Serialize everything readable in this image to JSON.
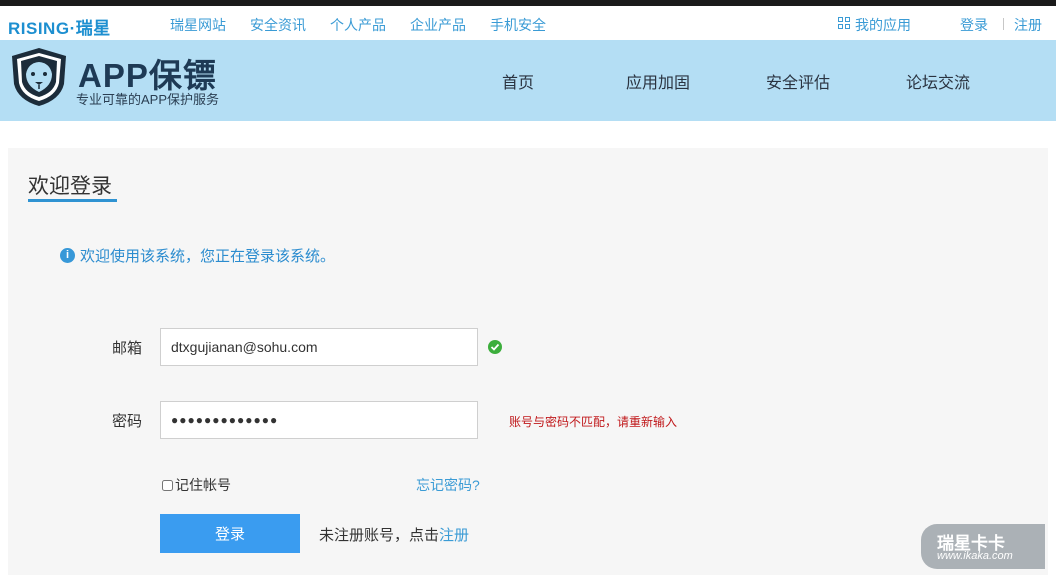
{
  "topbar": {
    "brand_en": "RISING",
    "brand_dot": "·",
    "brand_cn": "瑞星",
    "nav": [
      "瑞星网站",
      "安全资讯",
      "个人产品",
      "企业产品",
      "手机安全"
    ],
    "my_apps": "我的应用",
    "login": "登录",
    "register": "注册"
  },
  "header": {
    "title": "APP保镖",
    "subtitle": "专业可靠的APP保护服务",
    "nav": [
      "首页",
      "应用加固",
      "安全评估",
      "论坛交流"
    ]
  },
  "login": {
    "title": "欢迎登录",
    "info": "欢迎使用该系统，您正在登录该系统。",
    "email_label": "邮箱",
    "email_value": "dtxgujianan@sohu.com",
    "password_label": "密码",
    "password_value": "●●●●●●●●●●●●●",
    "error": "账号与密码不匹配，请重新输入",
    "remember": "记住帐号",
    "forgot": "忘记密码?",
    "submit": "登录",
    "no_account": "未注册账号，点击",
    "register_link": "注册"
  },
  "watermark": {
    "title": "瑞星卡卡",
    "url": "www.ikaka.com"
  },
  "colors": {
    "accent": "#2f93d2",
    "header_bg": "#b4def4",
    "button": "#3a9cf0",
    "error": "#c0181b"
  }
}
